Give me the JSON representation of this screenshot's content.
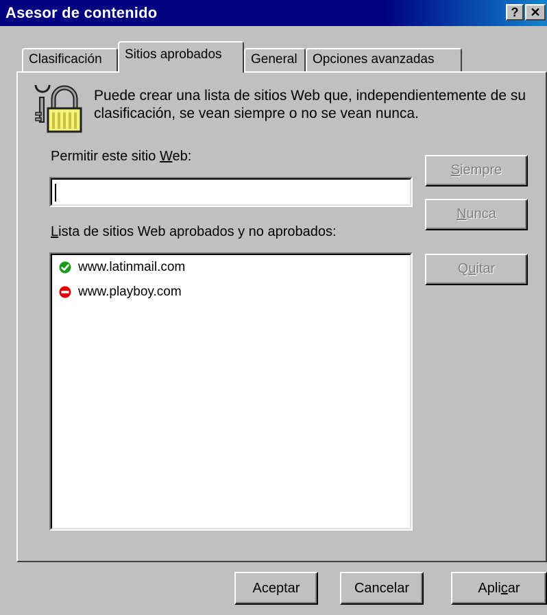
{
  "window": {
    "title": "Asesor de contenido",
    "help_label": "?",
    "close_label": "✕"
  },
  "tabs": [
    {
      "label": "Clasificación",
      "active": false
    },
    {
      "label": "Sitios aprobados",
      "active": true
    },
    {
      "label": "General",
      "active": false
    },
    {
      "label": "Opciones avanzadas",
      "active": false
    }
  ],
  "content": {
    "description": "Puede crear una lista de sitios Web que, independientemente de su clasificación, se vean siempre o no se vean nunca.",
    "permit_label_pre": "Permitir este sitio ",
    "permit_label_key": "W",
    "permit_label_post": "eb:",
    "site_input_value": "",
    "list_label_key": "L",
    "list_label_post": "ista de sitios Web aprobados y no aprobados:",
    "sites": [
      {
        "url": "www.latinmail.com",
        "status": "approved",
        "icon": "check-circle-icon",
        "color": "#1a9a1a"
      },
      {
        "url": "www.playboy.com",
        "status": "blocked",
        "icon": "no-entry-icon",
        "color": "#e00000"
      }
    ]
  },
  "side_buttons": {
    "always_key": "S",
    "always_rest": "iempre",
    "never_key": "N",
    "never_rest": "unca",
    "remove_pre": "Q",
    "remove_key": "u",
    "remove_rest": "itar"
  },
  "footer": {
    "accept": "Aceptar",
    "cancel": "Cancelar",
    "apply_pre": "Apli",
    "apply_key": "c",
    "apply_post": "ar"
  },
  "colors": {
    "titlebar": "#000080",
    "face": "#c0c0c0",
    "disabled_text": "#808080"
  }
}
